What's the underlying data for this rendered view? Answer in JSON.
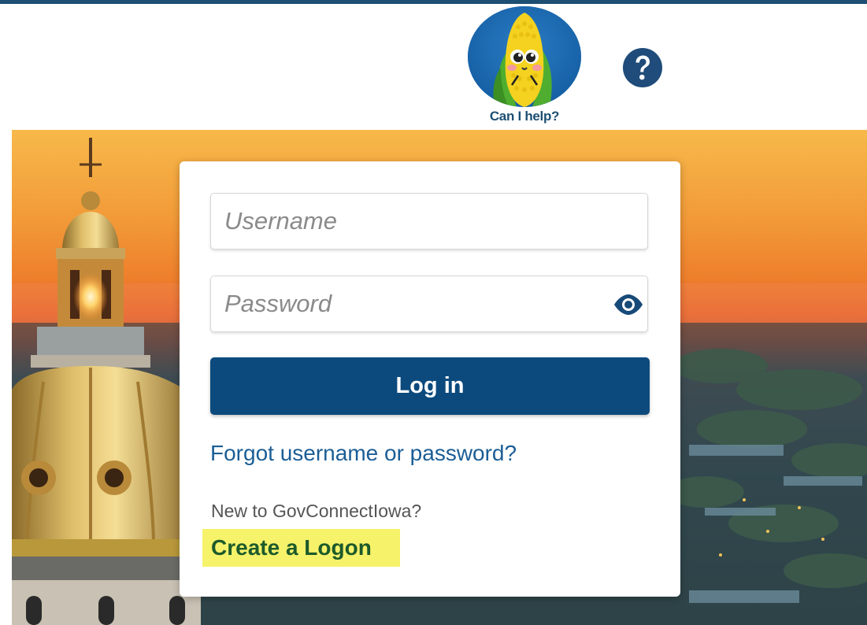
{
  "helper": {
    "caption": "Can I help?",
    "icon": "corn-mascot-icon"
  },
  "help_icon": "question-mark-icon",
  "login": {
    "username_placeholder": "Username",
    "password_placeholder": "Password",
    "show_password_icon": "eye-icon",
    "submit_label": "Log in",
    "forgot_link": "Forgot username or password?",
    "new_user_prompt": "New to GovConnectIowa?",
    "create_link": "Create a Logon"
  },
  "colors": {
    "primary": "#0c4a7d",
    "link": "#1b5e96",
    "highlight": "#f6f26a",
    "create_text": "#1d5a2a",
    "top_rule": "#1d4f73"
  }
}
